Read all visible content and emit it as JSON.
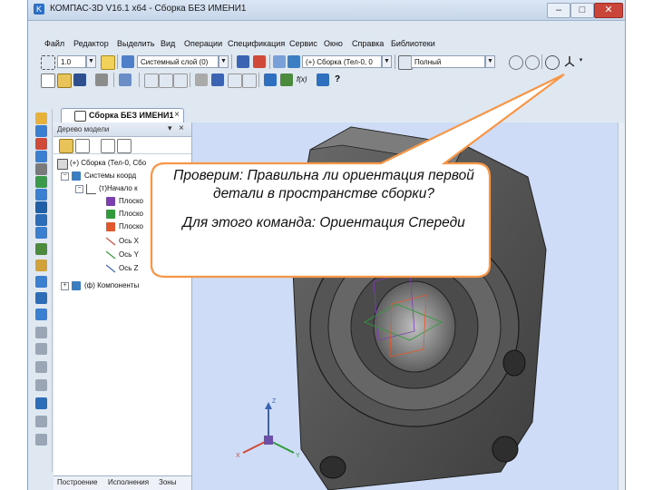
{
  "window": {
    "title": "КОМПАС-3D V16.1 x64 - Сборка БЕЗ ИМЕНИ1",
    "minimize": "–",
    "maximize": "□",
    "close": "✕"
  },
  "menu": [
    "Файл",
    "Редактор",
    "Выделить",
    "Вид",
    "Операции",
    "Спецификация",
    "Сервис",
    "Окно",
    "Справка",
    "Библиотеки"
  ],
  "toolbar": {
    "step_value": "1.0",
    "layer_value": "Системный слой (0)",
    "assembly_value": "(+) Сборка (Тел-0, 0",
    "display_mode": "Полный",
    "help_label": "?"
  },
  "document_tab": {
    "label": "Сборка БЕЗ ИМЕНИ1",
    "close": "×",
    "menu": "▼"
  },
  "tree": {
    "header": "Дерево модели",
    "close": "×",
    "pin": "▾",
    "rows": [
      {
        "label": "(+) Сборка (Тел-0, Сбо",
        "expander": ""
      },
      {
        "label": "Системы коорд",
        "expander": "−"
      },
      {
        "label": "(т)Начало к",
        "expander": "−"
      },
      {
        "label": "Плоско",
        "expander": ""
      },
      {
        "label": "Плоско",
        "expander": ""
      },
      {
        "label": "Плоско",
        "expander": ""
      },
      {
        "label": "Ось X",
        "expander": ""
      },
      {
        "label": "Ось Y",
        "expander": ""
      },
      {
        "label": "Ось Z",
        "expander": ""
      },
      {
        "label": "(ф) Компоненты",
        "expander": "+"
      }
    ],
    "bottom_tabs": [
      "Построение",
      "Исполнения",
      "Зоны"
    ]
  },
  "triad": {
    "x": "X",
    "y": "Y",
    "z": "Z"
  },
  "callout": {
    "line1": "Проверим: Правильна ли ориентация первой детали в пространстве сборки?",
    "line2": "Для этого команда: Ориентация Спереди"
  },
  "colors": {
    "callout_fill": "#ffffff",
    "callout_border": "#f79646",
    "viewport_bg": "#cfdcf7",
    "part_body": "#5a5a5a",
    "plane_front": "#7b3fb0",
    "plane_top": "#2f9b3a",
    "plane_side": "#e2572b"
  },
  "icons": {
    "app": "kompas-icon",
    "tree_assembly": "assembly-icon",
    "tree_csys": "coordinate-system-icon",
    "tree_plane": "plane-icon",
    "tree_axis": "axis-icon",
    "tree_components": "components-icon"
  }
}
